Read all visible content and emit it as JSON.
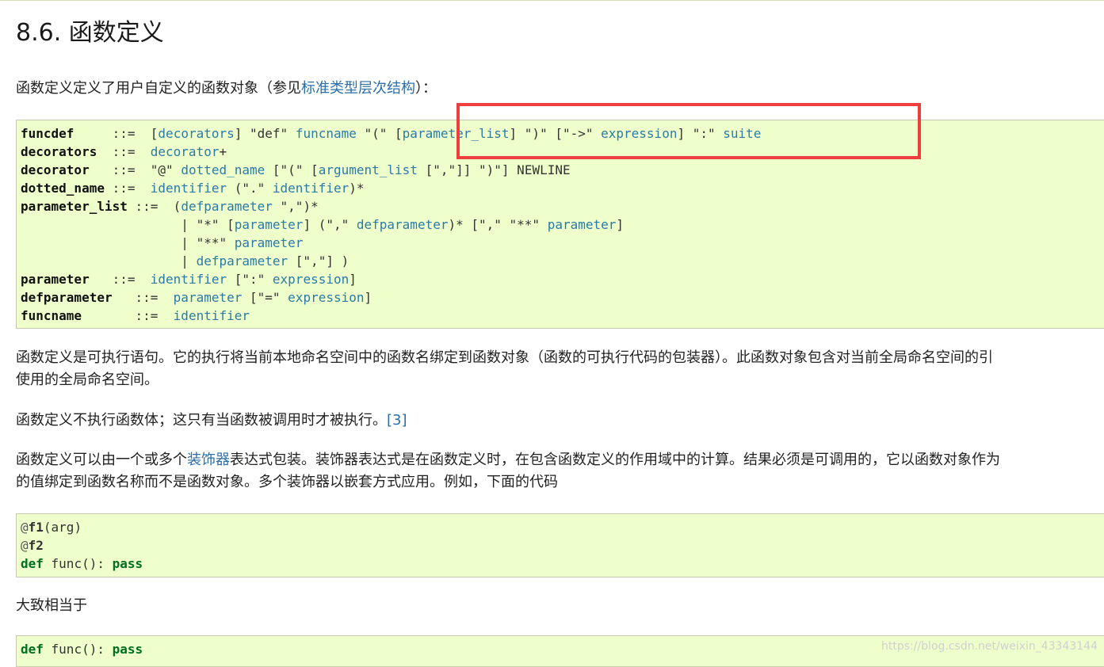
{
  "section": {
    "title": "8.6. 函数定义"
  },
  "intro": {
    "text_before": "函数定义定义了用户自定义的函数对象（参见",
    "link": "标准类型层次结构",
    "text_after": "）："
  },
  "grammar": {
    "funcdef": {
      "rule": "funcdef",
      "sep": "::=",
      "p1": "[",
      "p2": "decorators",
      "p3": "] \"def\" ",
      "p4": "funcname",
      "p5": " \"(\" [",
      "p6": "parameter_list",
      "p7": "] \")\" [\"->\" ",
      "p8": "expression",
      "p9": "] \":\" ",
      "p10": "suite"
    },
    "decorators": {
      "rule": "decorators",
      "sep": "::=",
      "p1": "decorator",
      "p2": "+"
    },
    "decorator": {
      "rule": "decorator",
      "sep": "::=",
      "p1": "\"@\" ",
      "p2": "dotted_name",
      "p3": " [\"(\" [",
      "p4": "argument_list",
      "p5": " [\",\"]] \")\"] NEWLINE"
    },
    "dotted_name": {
      "rule": "dotted_name",
      "sep": "::=",
      "p1": "identifier",
      "p2": " (\".\" ",
      "p3": "identifier",
      "p4": ")*"
    },
    "parameter_list": {
      "rule": "parameter_list",
      "sep": "::=",
      "l1": {
        "p1": "(",
        "p2": "defparameter",
        "p3": " \",\")*"
      },
      "l2": {
        "p1": "| \"*\" [",
        "p2": "parameter",
        "p3": "] (\",\" ",
        "p4": "defparameter",
        "p5": ")* [\",\" \"**\" ",
        "p6": "parameter",
        "p7": "]"
      },
      "l3": {
        "p1": "| \"**\" ",
        "p2": "parameter"
      },
      "l4": {
        "p1": "| ",
        "p2": "defparameter",
        "p3": " [\",\"] )"
      }
    },
    "parameter": {
      "rule": "parameter",
      "sep": "::=",
      "p1": "identifier",
      "p2": " [\":\" ",
      "p3": "expression",
      "p4": "]"
    },
    "defparameter": {
      "rule": "defparameter",
      "sep": "::=",
      "p1": "parameter",
      "p2": " [\"=\" ",
      "p3": "expression",
      "p4": "]"
    },
    "funcname": {
      "rule": "funcname",
      "sep": "::=",
      "p1": "identifier"
    }
  },
  "para1": {
    "line1": "函数定义是可执行语句。它的执行将当前本地命名空间中的函数名绑定到函数对象（函数的可执行代码的包装器）。此函数对象包含对当前全局命名空间的引",
    "line2": "使用的全局命名空间。"
  },
  "para2": {
    "text": "函数定义不执行函数体；这只有当函数被调用时才被执行。",
    "footnote": "[3]"
  },
  "para3": {
    "line1_before": "函数定义可以由一个或多个",
    "line1_link": "装饰器",
    "line1_after": "表达式包装。装饰器表达式是在函数定义时，在包含函数定义的作用域中的计算。结果必须是可调用的，它以函数对象作为",
    "line2": "的值绑定到函数名称而不是函数对象。多个装饰器以嵌套方式应用。例如，下面的代码"
  },
  "example1": {
    "l1": {
      "at": "@",
      "name": "f1",
      "rest": "(arg)"
    },
    "l2": {
      "at": "@",
      "name": "f2"
    },
    "l3": {
      "kw1": "def",
      "mid": " func(): ",
      "kw2": "pass"
    }
  },
  "para4": {
    "text": "大致相当于"
  },
  "example2": {
    "l1": {
      "kw1": "def",
      "mid": " func(): ",
      "kw2": "pass"
    }
  },
  "watermark": {
    "text": "https://blog.csdn.net/weixin_43343144"
  },
  "colors": {
    "code_bg": "#eeffcc",
    "link": "#2b7aa8",
    "keyword": "#007020",
    "highlight": "#ef3e3e"
  }
}
